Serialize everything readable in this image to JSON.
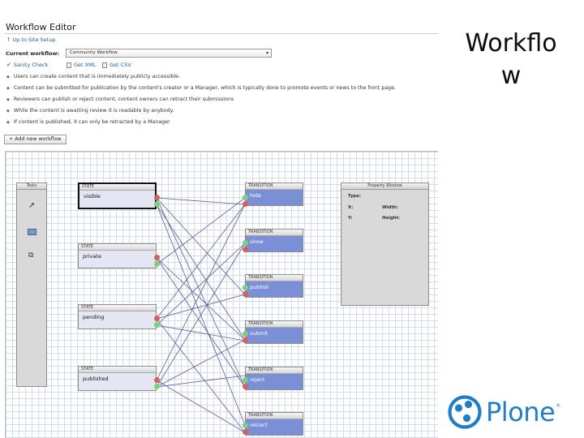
{
  "editor": {
    "title": "Workflow Editor",
    "up_link": "Up to Site Setup",
    "current_workflow_label": "Current workflow:",
    "current_workflow_value": "Community Workflow",
    "actions": {
      "sanity_check": "Sanity Check",
      "get_xml": "Get XML",
      "get_csv": "Get CSV"
    },
    "notes": [
      "Users can create content that is immediately publicly accessible.",
      "Content can be submitted for publication by the content's creator or a Manager, which is typically done to promote events or news to the front page.",
      "Reviewers can publish or reject content, content owners can retract their submissions",
      "While the content is awaiting review it is readable by anybody.",
      "If content is published, it can only be retracted by a Manager"
    ],
    "add_button": "Add new workflow"
  },
  "canvas": {
    "tools_title": "Tools",
    "property_window": {
      "title": "Property Window",
      "type_label": "Type:",
      "x_label": "X:",
      "y_label": "Y:",
      "width_label": "Width:",
      "height_label": "Height:"
    },
    "state_header": "STATE",
    "transition_header": "TRANSITION",
    "states": [
      "visible",
      "private",
      "pending",
      "published"
    ],
    "transitions": [
      "hide",
      "show",
      "publish",
      "submit",
      "reject",
      "retract"
    ]
  },
  "slide": {
    "title_line1": "Workflo",
    "title_line2": "w",
    "logo_text": "Plone",
    "logo_reg": "®"
  },
  "colors": {
    "transition_fill": "#7b8fd6",
    "state_fill": "#e4e6f4",
    "wire": "#5a5f9a",
    "dot_red": "#d46060",
    "dot_green": "#7bd07b",
    "plone_blue": "#1f7ec7"
  }
}
